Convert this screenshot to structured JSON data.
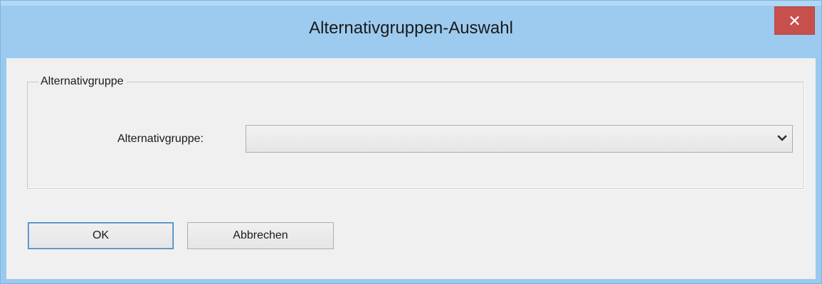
{
  "window": {
    "title": "Alternativgruppen-Auswahl",
    "close_glyph": "✕"
  },
  "group": {
    "legend": "Alternativgruppe",
    "field_label": "Alternativgruppe:",
    "selected_value": ""
  },
  "buttons": {
    "ok_label": "OK",
    "cancel_label": "Abbrechen"
  },
  "icons": {
    "close": "close-icon",
    "dropdown": "chevron-down-icon"
  },
  "colors": {
    "title_bar": "#9ccbef",
    "close_button": "#c7504d",
    "dialog_background": "#f0f0f0",
    "default_button_border": "#3c7fb1"
  }
}
